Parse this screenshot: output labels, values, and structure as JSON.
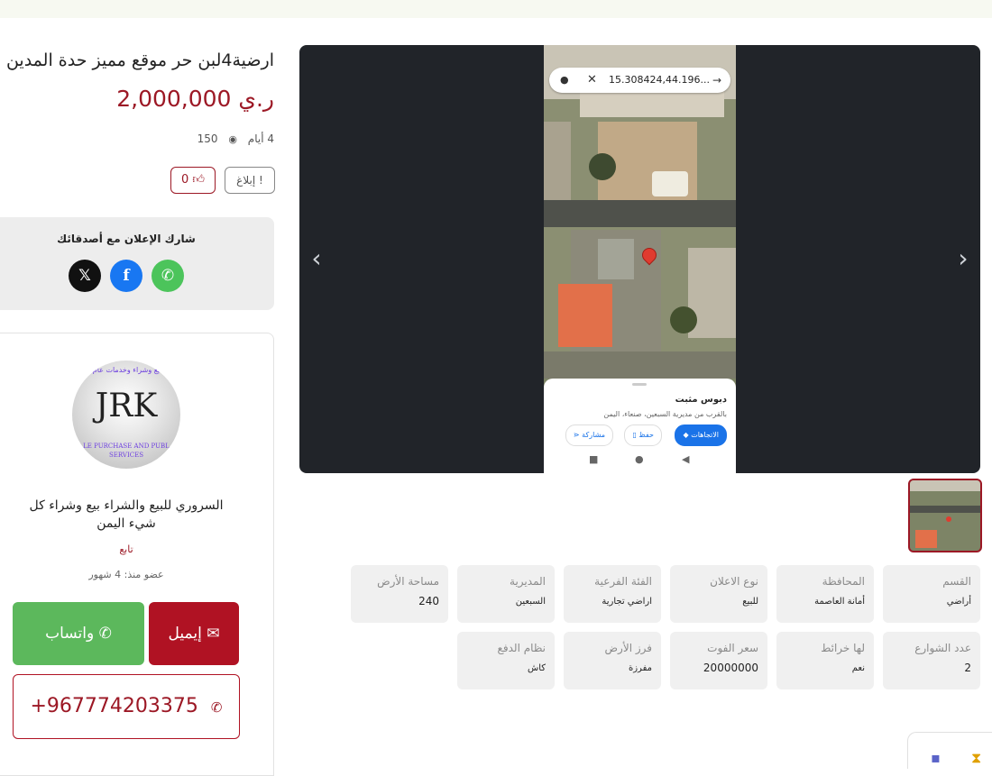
{
  "listing": {
    "title": "ارضية4لبن حر موقع مميز حدة المدين",
    "price": "2,000,000 ر.ي",
    "age": "4 أيام",
    "views": "150",
    "likes": "0",
    "report_label": "إبلاغ"
  },
  "share": {
    "heading": "شارك الإعلان مع أصدقائك",
    "networks": [
      "whatsapp",
      "facebook",
      "x"
    ]
  },
  "seller": {
    "logo_top_text": "يع وشراء وخدمات عام",
    "logo_monogram": "JRK",
    "logo_bottom_text": "LE PURCHASE AND PUBL SERVICES",
    "name": "السروري للبيع والشراء بيع وشراء كل شيء اليمن",
    "follow_label": "تابع",
    "member_since": "عضو منذ: 4 شهور",
    "whatsapp_label": "واتساب",
    "email_label": "إيميل",
    "phone": "+967774203375"
  },
  "gallery": {
    "map_search_text": "15.308424,44.196...",
    "place_title": "دبوس مثبت",
    "place_subtitle": "بالقرب من مديرية السبعين، صنعاء، اليمن",
    "btn_directions": "الاتجاهات",
    "btn_save": "حفظ",
    "btn_share": "مشاركة"
  },
  "details": [
    {
      "label": "القسم",
      "value": "أراضي"
    },
    {
      "label": "المحافظة",
      "value": "أمانة العاصمة"
    },
    {
      "label": "نوع الاعلان",
      "value": "للبيع"
    },
    {
      "label": "الفئة الفرعية",
      "value": "اراضي تجارية"
    },
    {
      "label": "المديرية",
      "value": "السبعين"
    },
    {
      "label": "مساحة الأرض",
      "value": "240"
    },
    {
      "label": "عدد الشوارع",
      "value": "2"
    },
    {
      "label": "لها خرائط",
      "value": "نعم"
    },
    {
      "label": "سعر الفوت",
      "value": "20000000"
    },
    {
      "label": "فرز الأرض",
      "value": "مفرزة"
    },
    {
      "label": "نظام الدفع",
      "value": "كاش"
    }
  ],
  "colors": {
    "brand": "#9c1825",
    "whatsapp": "#5cb85c",
    "email": "#b01223",
    "facebook": "#1877f2",
    "x": "#111111"
  }
}
